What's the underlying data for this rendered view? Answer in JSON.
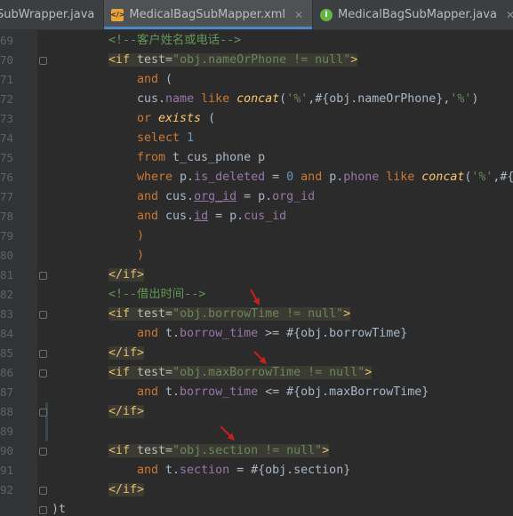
{
  "tabs": [
    {
      "label": "SubWrapper.java",
      "icon": "none",
      "active": false,
      "closable": false
    },
    {
      "label": "MedicalBagSubMapper.xml",
      "icon": "xml-file-icon",
      "active": true,
      "closable": true
    },
    {
      "label": "MedicalBagSubMapper.java",
      "icon": "interface-icon",
      "active": false,
      "closable": true
    },
    {
      "label": "M",
      "icon": "class-icon",
      "active": false,
      "closable": false
    }
  ],
  "line_numbers": [
    "69",
    "70",
    "71",
    "72",
    "73",
    "74",
    "75",
    "76",
    "77",
    "78",
    "79",
    "80",
    "81",
    "82",
    "83",
    "84",
    "85",
    "86",
    "87",
    "88",
    "89",
    "90",
    "91",
    "92",
    ""
  ],
  "code_lines": [
    {
      "indent": 8,
      "hl": false,
      "tokens": [
        [
          "<!--客户姓名或电话-->",
          "comment"
        ]
      ]
    },
    {
      "indent": 8,
      "hl": true,
      "tokens": [
        [
          "<if ",
          "tag"
        ],
        [
          "test=",
          "attr"
        ],
        [
          "\"obj.nameOrPhone != null\"",
          "str"
        ],
        [
          ">",
          "tag"
        ]
      ]
    },
    {
      "indent": 12,
      "hl": false,
      "tokens": [
        [
          "and",
          "kw"
        ],
        [
          " (",
          "plain"
        ]
      ]
    },
    {
      "indent": 12,
      "hl": false,
      "tokens": [
        [
          "cus",
          "plain"
        ],
        [
          ".",
          "plain"
        ],
        [
          "name",
          "field"
        ],
        [
          " like ",
          "kw"
        ],
        [
          "concat",
          "fn"
        ],
        [
          "(",
          "plain"
        ],
        [
          "'%'",
          "sqlstr"
        ],
        [
          ",#{obj.nameOrPhone},",
          "plain"
        ],
        [
          "'%'",
          "sqlstr"
        ],
        [
          ")",
          "plain"
        ]
      ]
    },
    {
      "indent": 12,
      "hl": false,
      "tokens": [
        [
          "or ",
          "kw"
        ],
        [
          "exists",
          "fn"
        ],
        [
          " (",
          "plain"
        ]
      ]
    },
    {
      "indent": 12,
      "hl": false,
      "tokens": [
        [
          "select ",
          "kw"
        ],
        [
          "1",
          "num"
        ]
      ]
    },
    {
      "indent": 12,
      "hl": false,
      "tokens": [
        [
          "from ",
          "kw"
        ],
        [
          "t_cus_phone p",
          "plain"
        ]
      ]
    },
    {
      "indent": 12,
      "hl": false,
      "tokens": [
        [
          "where ",
          "kw"
        ],
        [
          "p.",
          "plain"
        ],
        [
          "is_deleted",
          "field"
        ],
        [
          " = ",
          "plain"
        ],
        [
          "0",
          "num"
        ],
        [
          " and ",
          "kw"
        ],
        [
          "p.",
          "plain"
        ],
        [
          "phone",
          "field"
        ],
        [
          " like ",
          "kw"
        ],
        [
          "concat",
          "fn"
        ],
        [
          "(",
          "plain"
        ],
        [
          "'%'",
          "sqlstr"
        ],
        [
          ",#{",
          "plain"
        ]
      ]
    },
    {
      "indent": 12,
      "hl": false,
      "tokens": [
        [
          "and ",
          "kw"
        ],
        [
          "cus.",
          "plain"
        ],
        [
          "org_id",
          "field-ul"
        ],
        [
          " = ",
          "plain"
        ],
        [
          "p.",
          "plain"
        ],
        [
          "org_id",
          "field"
        ]
      ]
    },
    {
      "indent": 12,
      "hl": false,
      "tokens": [
        [
          "and ",
          "kw"
        ],
        [
          "cus.",
          "plain"
        ],
        [
          "id",
          "field-ul"
        ],
        [
          " = ",
          "plain"
        ],
        [
          "p.",
          "plain"
        ],
        [
          "cus_id",
          "field"
        ]
      ]
    },
    {
      "indent": 12,
      "hl": false,
      "tokens": [
        [
          ")",
          "kw"
        ]
      ]
    },
    {
      "indent": 12,
      "hl": false,
      "tokens": [
        [
          ")",
          "kw"
        ]
      ]
    },
    {
      "indent": 8,
      "hl": true,
      "tokens": [
        [
          "</if>",
          "tag"
        ]
      ]
    },
    {
      "indent": 8,
      "hl": false,
      "tokens": [
        [
          "<!--借出时间-->",
          "comment"
        ]
      ]
    },
    {
      "indent": 8,
      "hl": true,
      "tokens": [
        [
          "<if ",
          "tag"
        ],
        [
          "test=",
          "attr"
        ],
        [
          "\"obj.borrowTime != null\"",
          "str"
        ],
        [
          ">",
          "tag"
        ]
      ]
    },
    {
      "indent": 12,
      "hl": false,
      "tokens": [
        [
          "and ",
          "kw"
        ],
        [
          "t.",
          "plain"
        ],
        [
          "borrow_time",
          "field"
        ],
        [
          " >= ",
          "plain"
        ],
        [
          "#{obj.borrowTime}",
          "plain"
        ]
      ]
    },
    {
      "indent": 8,
      "hl": true,
      "tokens": [
        [
          "</if>",
          "tag"
        ]
      ]
    },
    {
      "indent": 8,
      "hl": true,
      "tokens": [
        [
          "<if ",
          "tag"
        ],
        [
          "test=",
          "attr"
        ],
        [
          "\"obj.maxBorrowTime != null\"",
          "str"
        ],
        [
          ">",
          "tag"
        ]
      ]
    },
    {
      "indent": 12,
      "hl": false,
      "tokens": [
        [
          "and ",
          "kw"
        ],
        [
          "t.",
          "plain"
        ],
        [
          "borrow_time",
          "field"
        ],
        [
          " <= ",
          "plain"
        ],
        [
          "#{obj.maxBorrowTime}",
          "plain"
        ]
      ]
    },
    {
      "indent": 8,
      "hl": true,
      "tokens": [
        [
          "</if>",
          "tag"
        ]
      ]
    },
    {
      "indent": 8,
      "hl": false,
      "tokens": []
    },
    {
      "indent": 8,
      "hl": true,
      "tokens": [
        [
          "<if ",
          "tag"
        ],
        [
          "test=",
          "attr"
        ],
        [
          "\"obj.section != null\"",
          "str"
        ],
        [
          ">",
          "tag"
        ]
      ]
    },
    {
      "indent": 12,
      "hl": false,
      "tokens": [
        [
          "and ",
          "kw"
        ],
        [
          "t.",
          "plain"
        ],
        [
          "section",
          "field"
        ],
        [
          " = ",
          "plain"
        ],
        [
          "#{obj.section}",
          "plain"
        ]
      ]
    },
    {
      "indent": 8,
      "hl": true,
      "tokens": [
        [
          "</if>",
          "tag"
        ]
      ]
    },
    {
      "indent": 0,
      "hl": false,
      "tokens": [
        [
          ")t",
          "plain"
        ]
      ]
    }
  ],
  "annotations": [
    {
      "type": "red-arrow",
      "points_to": "obj.borrowTime"
    },
    {
      "type": "red-arrow",
      "points_to": "obj.maxBorrowTime"
    },
    {
      "type": "red-arrow",
      "points_to": "obj.section"
    }
  ],
  "colors": {
    "editor_bg": "#2b2b2b",
    "keyword": "#cc7832",
    "string": "#6a8759",
    "field": "#9876aa",
    "comment": "#629755",
    "tag": "#e8bf6a",
    "arrow": "#c8201e"
  }
}
